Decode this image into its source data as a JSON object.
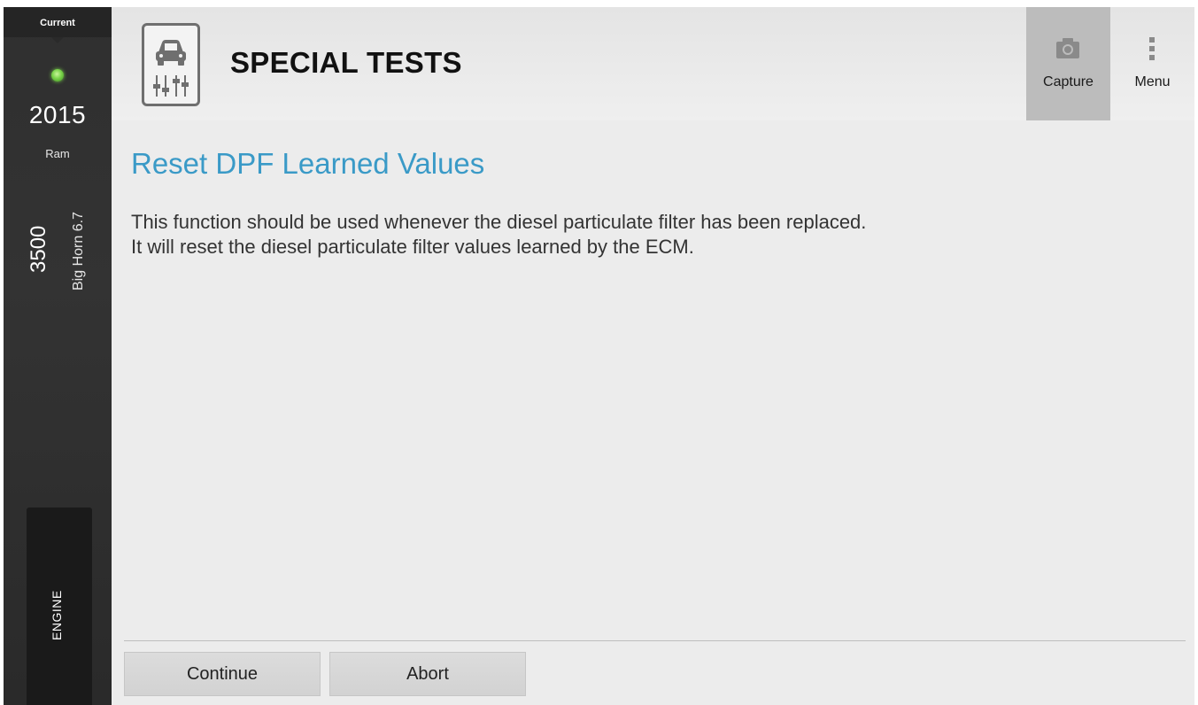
{
  "sidebar": {
    "status_label": "Current",
    "status_led_color": "#7ad34a",
    "year": "2015",
    "make": "Ram",
    "model": "3500",
    "trim": "Big Horn 6.7",
    "system_tab": "ENGINE"
  },
  "header": {
    "icon": "car-sliders-icon",
    "title": "SPECIAL TESTS",
    "capture_label": "Capture",
    "capture_icon": "camera-icon",
    "menu_label": "Menu",
    "menu_icon": "vertical-dots-icon"
  },
  "main": {
    "title": "Reset DPF Learned Values",
    "title_color": "#3a9ac7",
    "description_lines": [
      "This function should be used whenever the diesel particulate filter has been replaced.",
      "It will reset the diesel particulate filter values learned by the ECM."
    ]
  },
  "actions": {
    "continue_label": "Continue",
    "abort_label": "Abort"
  }
}
